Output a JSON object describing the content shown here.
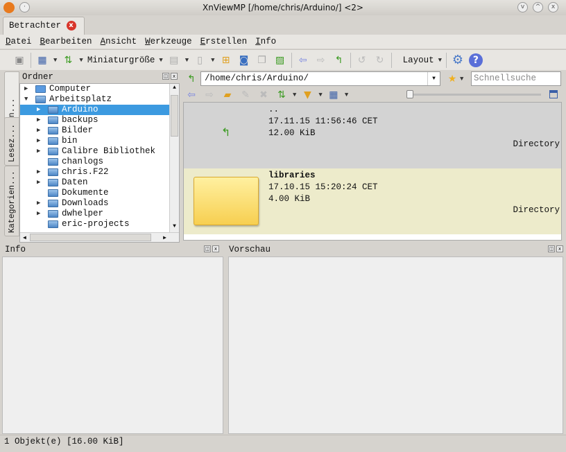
{
  "window": {
    "title": "XnViewMP [/home/chris/Arduino/] <2>"
  },
  "tab": {
    "label": "Betrachter"
  },
  "menu": [
    {
      "label": "Datei",
      "u": "D",
      "rest": "atei"
    },
    {
      "label": "Bearbeiten",
      "u": "B",
      "rest": "earbeiten"
    },
    {
      "label": "Ansicht",
      "u": "A",
      "rest": "nsicht"
    },
    {
      "label": "Werkzeuge",
      "u": "W",
      "rest": "erkzeuge"
    },
    {
      "label": "Erstellen",
      "u": "E",
      "rest": "rstellen"
    },
    {
      "label": "Info",
      "u": "I",
      "rest": "nfo"
    }
  ],
  "toolbar": {
    "thumb_size": "Miniaturgröße",
    "layout": "Layout"
  },
  "sidetabs": [
    "Ordn...",
    "Lesez...",
    "Kategorien..."
  ],
  "folders": {
    "title": "Ordner",
    "items": [
      {
        "label": "Computer",
        "level": 0,
        "exp": "closed",
        "icon": "computer"
      },
      {
        "label": "Arbeitsplatz",
        "level": 0,
        "exp": "open",
        "icon": "folder"
      },
      {
        "label": "Arduino",
        "level": 1,
        "exp": "closed",
        "sel": true
      },
      {
        "label": "backups",
        "level": 1,
        "exp": "closed"
      },
      {
        "label": "Bilder",
        "level": 1,
        "exp": "closed"
      },
      {
        "label": "bin",
        "level": 1,
        "exp": "closed"
      },
      {
        "label": "Calibre Bibliothek",
        "level": 1,
        "exp": "closed"
      },
      {
        "label": "chanlogs",
        "level": 1,
        "exp": "none"
      },
      {
        "label": "chris.F22",
        "level": 1,
        "exp": "closed"
      },
      {
        "label": "Daten",
        "level": 1,
        "exp": "closed"
      },
      {
        "label": "Dokumente",
        "level": 1,
        "exp": "none"
      },
      {
        "label": "Downloads",
        "level": 1,
        "exp": "closed"
      },
      {
        "label": "dwhelper",
        "level": 1,
        "exp": "closed"
      },
      {
        "label": "eric-projects",
        "level": 1,
        "exp": "none"
      }
    ]
  },
  "address": {
    "path": "/home/chris/Arduino/",
    "search_placeholder": "Schnellsuche"
  },
  "files": [
    {
      "name": "..",
      "date": "17.11.15 11:56:46 CET",
      "size": "12.00 KiB",
      "type": "Directory"
    },
    {
      "name": "libraries",
      "date": "17.10.15 15:20:24 CET",
      "size": "4.00 KiB",
      "type": "Directory"
    }
  ],
  "panels": {
    "info": "Info",
    "preview": "Vorschau"
  },
  "status": "1 Objekt(e) [16.00 KiB]"
}
